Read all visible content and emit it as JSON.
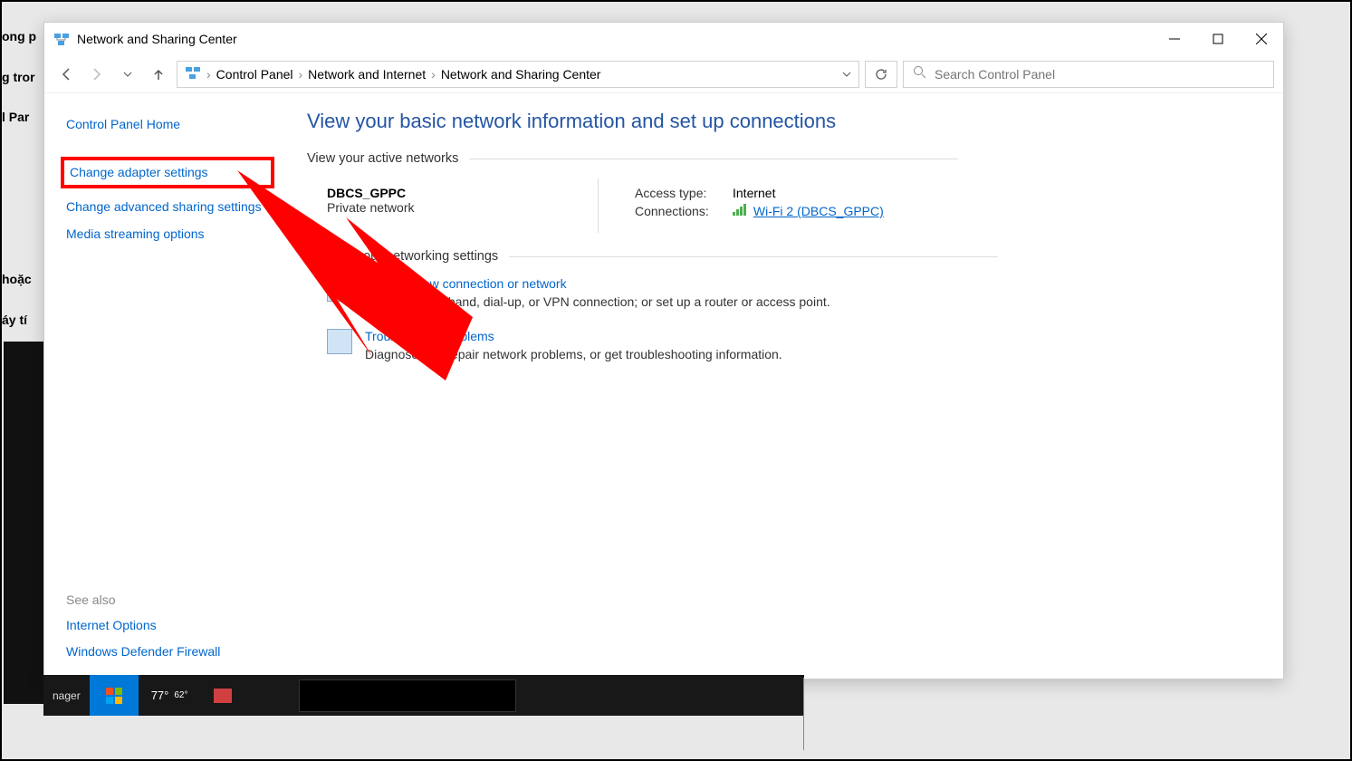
{
  "bg_text": {
    "t1": "ong p",
    "t2": "g tror",
    "t3": "l Par",
    "t4": "hoặc",
    "t5": "áy tí"
  },
  "window": {
    "title": "Network and Sharing Center",
    "breadcrumb": {
      "root": "Control Panel",
      "level1": "Network and Internet",
      "level2": "Network and Sharing Center"
    },
    "search_placeholder": "Search Control Panel"
  },
  "sidebar": {
    "home": "Control Panel Home",
    "links": {
      "adapter": "Change adapter settings",
      "advanced": "Change advanced sharing settings",
      "media": "Media streaming options"
    },
    "seealso_label": "See also",
    "seealso": {
      "internet": "Internet Options",
      "firewall": "Windows Defender Firewall"
    }
  },
  "main": {
    "heading": "View your basic network information and set up connections",
    "active_label": "View your active networks",
    "network": {
      "name": "DBCS_GPPC",
      "type": "Private network",
      "access_label": "Access type:",
      "access_value": "Internet",
      "conn_label": "Connections:",
      "conn_link": "Wi-Fi 2 (DBCS_GPPC)"
    },
    "change_label": "Change your networking settings",
    "setup": {
      "title": "Set up a new connection or network",
      "desc": "Set up a broadband, dial-up, or VPN connection; or set up a router or access point."
    },
    "trouble": {
      "title": "Troubleshoot problems",
      "desc": "Diagnose and repair network problems, or get troubleshooting information."
    }
  },
  "taskbar": {
    "manager": "nager",
    "temp": "77°",
    "temp2": "62°"
  }
}
